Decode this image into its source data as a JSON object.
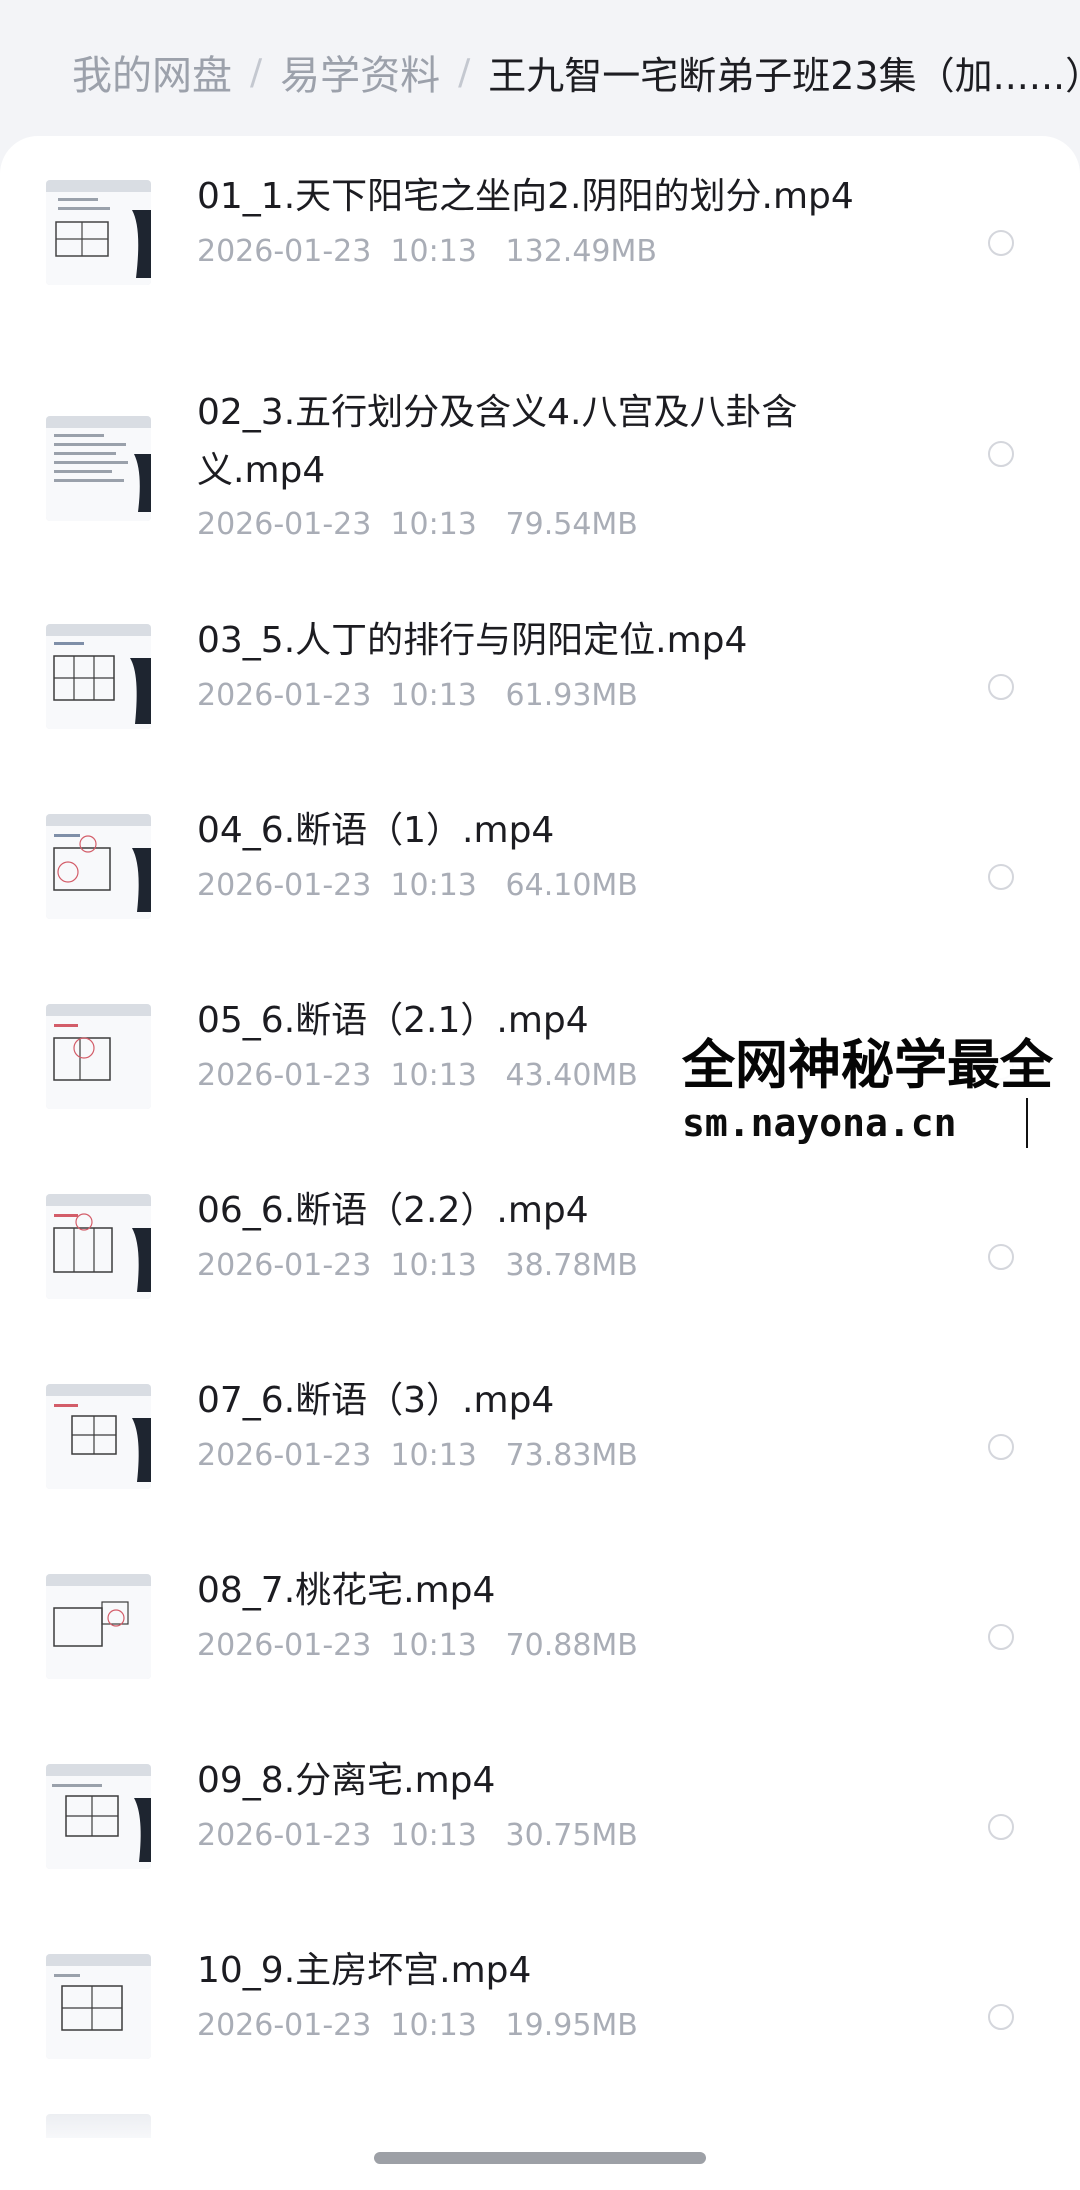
{
  "breadcrumb": {
    "root": "我的网盘",
    "folder": "易学资料",
    "current": "王九智一宅断弟子班23集（加......）"
  },
  "files": [
    {
      "name": "01_1.天下阳宅之坐向2.阴阳的划分.mp4",
      "date": "2026-01-23",
      "time": "10:13",
      "size": "132.49MB"
    },
    {
      "name": "02_3.五行划分及含义4.八宫及八卦含义.mp4",
      "date": "2026-01-23",
      "time": "10:13",
      "size": "79.54MB"
    },
    {
      "name": "03_5.人丁的排行与阴阳定位.mp4",
      "date": "2026-01-23",
      "time": "10:13",
      "size": "61.93MB"
    },
    {
      "name": "04_6.断语（1）.mp4",
      "date": "2026-01-23",
      "time": "10:13",
      "size": "64.10MB"
    },
    {
      "name": "05_6.断语（2.1）.mp4",
      "date": "2026-01-23",
      "time": "10:13",
      "size": "43.40MB"
    },
    {
      "name": "06_6.断语（2.2）.mp4",
      "date": "2026-01-23",
      "time": "10:13",
      "size": "38.78MB"
    },
    {
      "name": "07_6.断语（3）.mp4",
      "date": "2026-01-23",
      "time": "10:13",
      "size": "73.83MB"
    },
    {
      "name": "08_7.桃花宅.mp4",
      "date": "2026-01-23",
      "time": "10:13",
      "size": "70.88MB"
    },
    {
      "name": "09_8.分离宅.mp4",
      "date": "2026-01-23",
      "time": "10:13",
      "size": "30.75MB"
    },
    {
      "name": "10_9.主房坏宫.mp4",
      "date": "2026-01-23",
      "time": "10:13",
      "size": "19.95MB"
    }
  ],
  "watermark": {
    "title": "全网神秘学最全",
    "url": "sm.nayona.cn"
  },
  "icons": {
    "thumbnail": "video-thumbnail-icon",
    "select": "radio-circle-icon"
  },
  "colors": {
    "background": "#f3f4f7",
    "panel": "#ffffff",
    "muted_text": "#a9adb6",
    "primary_text": "#1c1c21",
    "radio_border": "#d4d6dc"
  }
}
